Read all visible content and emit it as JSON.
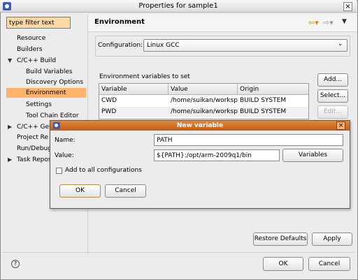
{
  "window": {
    "title": "Properties for sample1",
    "close": "×"
  },
  "filter": {
    "placeholder": "type filter text"
  },
  "nav": {
    "resource": "Resource",
    "builders": "Builders",
    "cpp_build": "C/C++ Build",
    "build_variables": "Build Variables",
    "discovery_options": "Discovery Options",
    "environment": "Environment",
    "settings": "Settings",
    "tool_chain_editor": "Tool Chain Editor",
    "cpp_general": "C/C++ Gen",
    "project_refs": "Project Re",
    "run_debug": "Run/Debug",
    "task_repo": "Task Repos"
  },
  "page": {
    "title": "Environment"
  },
  "config": {
    "label": "Configuration:",
    "value": "Linux GCC"
  },
  "env": {
    "label": "Environment variables to set",
    "columns": [
      "Variable",
      "Value",
      "Origin"
    ],
    "rows": [
      {
        "variable": "CWD",
        "value": "/home/suikan/workspa",
        "origin": "BUILD SYSTEM"
      },
      {
        "variable": "PWD",
        "value": "/home/suikan/workspa",
        "origin": "BUILD SYSTEM"
      }
    ],
    "add": "Add...",
    "select": "Select...",
    "edit": "Edit..."
  },
  "footer": {
    "restore_defaults": "Restore Defaults",
    "apply": "Apply",
    "ok": "OK",
    "cancel": "Cancel"
  },
  "dialog": {
    "title": "New variable",
    "name_label": "Name:",
    "name_value": "PATH",
    "value_label": "Value:",
    "value_value": "${PATH}:/opt/arm-2009q1/bin",
    "variables": "Variables",
    "add_all": "Add to all configurations",
    "ok": "OK",
    "cancel": "Cancel"
  },
  "colors": {
    "selection": "#ffb36b",
    "dialog_title": "#c35d16",
    "filter_bg": "#ffd8a8"
  }
}
